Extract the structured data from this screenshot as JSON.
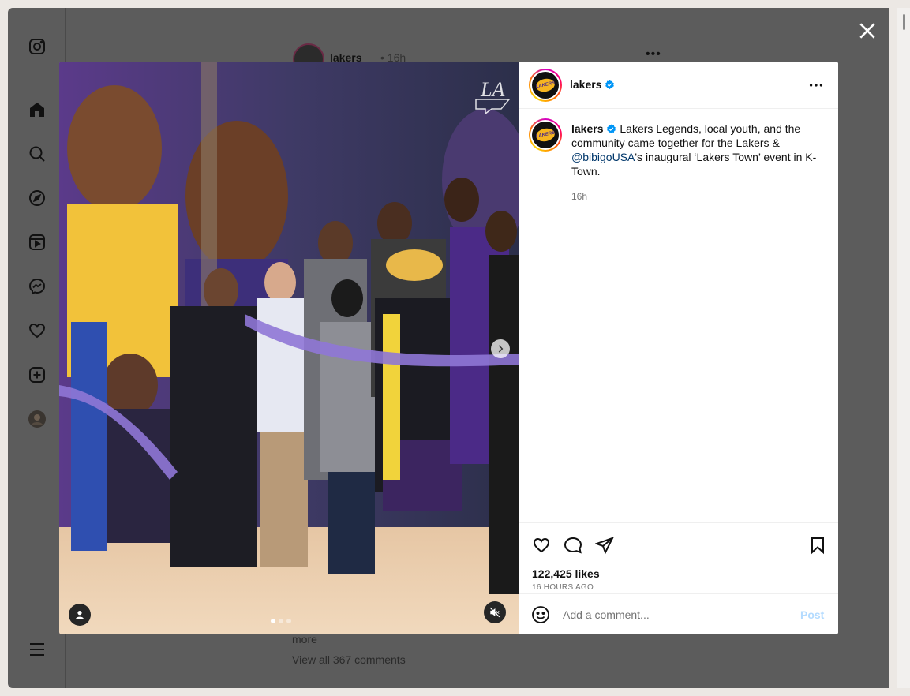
{
  "background_feed": {
    "username": "lakers",
    "time": "• 16h",
    "more_text": "more",
    "view_comments": "View all 367 comments"
  },
  "nav": {
    "items": [
      "instagram-icon",
      "home-icon",
      "search-icon",
      "explore-icon",
      "reels-icon",
      "messenger-icon",
      "heart-icon",
      "create-icon",
      "profile-avatar",
      "menu-icon"
    ]
  },
  "modal": {
    "header": {
      "username": "lakers",
      "verified": true
    },
    "caption": {
      "username": "lakers",
      "text_before": " Lakers Legends, local youth, and the community came together for the Lakers & ",
      "mention": "@bibigoUSA",
      "text_after": "'s inaugural ‘Lakers Town’ event in K-Town.",
      "time": "16h"
    },
    "media": {
      "watermark": "LA",
      "carousel_dots": 3,
      "active_dot": 0
    },
    "likes": "122,425 likes",
    "posted_ago": "16 HOURS AGO",
    "comment_placeholder": "Add a comment...",
    "post_label": "Post"
  },
  "colors": {
    "overlay": "#5c5c5c",
    "verified": "#0095f6",
    "mention": "#00376b",
    "post_disabled": "#b3dbff"
  }
}
